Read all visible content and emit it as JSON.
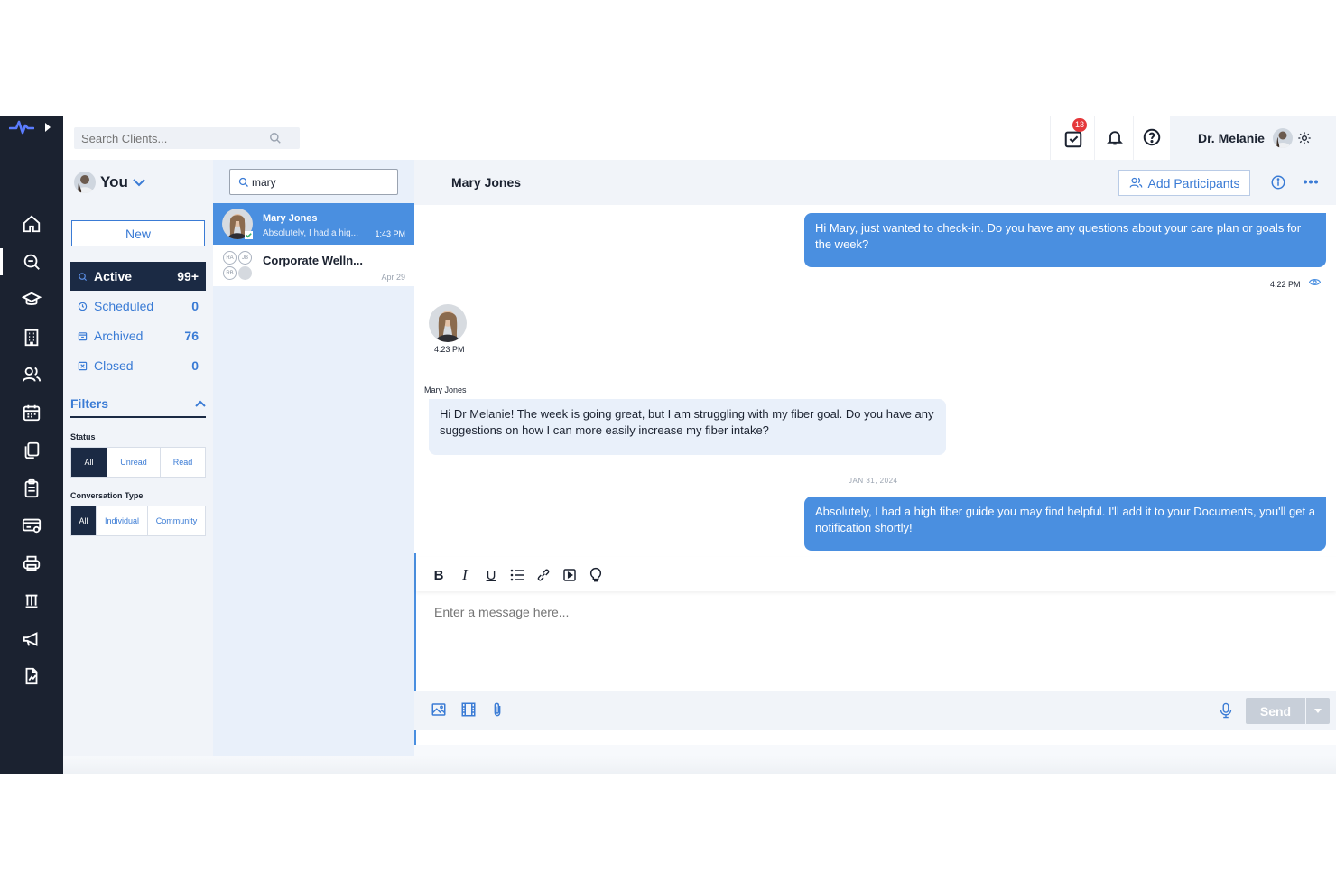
{
  "topbar": {
    "search_placeholder": "Search Clients...",
    "tasks_badge": "13",
    "user_name": "Dr. Melanie"
  },
  "rail": {
    "icons": [
      "home-icon",
      "chat-icon",
      "education-icon",
      "building-icon",
      "users-icon",
      "calendar-icon",
      "documents-icon",
      "clipboard-icon",
      "billing-icon",
      "print-icon",
      "supplements-icon",
      "megaphone-icon",
      "reports-icon"
    ],
    "active": "chat-icon"
  },
  "filter_panel": {
    "owner_label": "You",
    "new_button": "New",
    "statuses": [
      {
        "label": "Active",
        "count": "99+"
      },
      {
        "label": "Scheduled",
        "count": "0"
      },
      {
        "label": "Archived",
        "count": "76"
      },
      {
        "label": "Closed",
        "count": "0"
      }
    ],
    "filters_label": "Filters",
    "status_title": "Status",
    "status_options": [
      "All",
      "Unread",
      "Read"
    ],
    "type_title": "Conversation Type",
    "type_options": [
      "All",
      "Individual",
      "Community"
    ]
  },
  "conversation_list": {
    "search_value": "mary",
    "items": [
      {
        "name": "Mary Jones",
        "preview": "Absolutely, I had a hig...",
        "time": "1:43 PM"
      },
      {
        "name": "Corporate Welln...",
        "preview": "",
        "time": "Apr 29",
        "participants": [
          "RA",
          "JB",
          "RB"
        ]
      }
    ]
  },
  "chat": {
    "title": "Mary Jones",
    "add_participants": "Add Participants",
    "messages": [
      {
        "direction": "out",
        "text": "Hi Mary, just wanted to check-in. Do you have any questions about your care plan or goals for the week?",
        "time": "4:22 PM"
      },
      {
        "direction": "in",
        "sender_time": "4:23 PM",
        "sender": "Mary Jones",
        "text": "Hi Dr Melanie! The week is going great, but I am struggling with my fiber goal. Do you have any suggestions on how I can more easily increase my fiber intake?"
      },
      {
        "direction": "out",
        "text": "Absolutely, I had a high fiber guide you may find helpful. I'll add it to your Documents, you'll get a notification shortly!"
      }
    ],
    "date_separator": "JAN 31, 2024"
  },
  "composer": {
    "toolbar": [
      "bold-icon",
      "italic-icon",
      "underline-icon",
      "list-icon",
      "link-icon",
      "video-embed-icon",
      "lightbulb-icon"
    ],
    "placeholder": "Enter a message here...",
    "send_label": "Send"
  },
  "colors": {
    "rail_bg": "#1b2230",
    "accent": "#3a7bd5",
    "bubble_out": "#4a8fe0",
    "bubble_in": "#e9f0fa",
    "badge": "#e5383b"
  }
}
